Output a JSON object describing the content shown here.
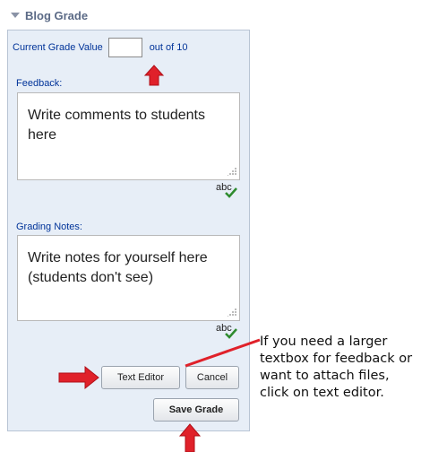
{
  "section": {
    "title": "Blog Grade"
  },
  "grade": {
    "label": "Current Grade Value",
    "value": "",
    "suffix": "out of 10"
  },
  "feedback": {
    "label": "Feedback:",
    "text": "Write comments to students here"
  },
  "notes": {
    "label": "Grading Notes:",
    "text": "Write notes for yourself here (students don't see)"
  },
  "spellcheck": {
    "label": "abc"
  },
  "buttons": {
    "text_editor": "Text Editor",
    "cancel": "Cancel",
    "save": "Save Grade"
  },
  "annotation": {
    "text": "If you need a larger textbox for feedback or want to attach files, click on text editor."
  },
  "colors": {
    "arrow": "#e0212a",
    "label": "#003399",
    "panel_bg": "#e7eef7",
    "check": "#2e8b2e"
  }
}
